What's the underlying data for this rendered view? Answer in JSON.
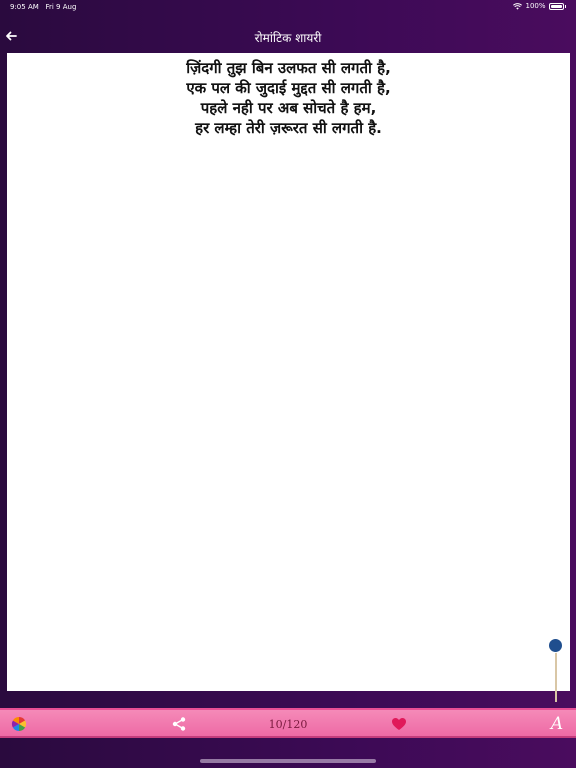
{
  "status": {
    "time": "9:05 AM",
    "date": "Fri 9 Aug",
    "battery": "100%"
  },
  "header": {
    "title": "रोमांटिक शायरी"
  },
  "poem": {
    "lines": [
      "ज़िंदगी तुझ बिन उलफत सी लगती है,",
      "एक पल की जुदाई मुद्दत सी लगती है,",
      "पहले नही पर अब सोचते है हम,",
      "हर लम्हा तेरी ज़रूरत सी लगती है."
    ]
  },
  "slider": {
    "value": 1.0
  },
  "bottom_bar": {
    "page_counter": "10/120",
    "font_label": "A"
  },
  "colors": {
    "background": "#3c0a55",
    "bottom_bar": "#ee6aa5",
    "heart": "#e0195a",
    "slider_knob": "#1f4e8e"
  },
  "icons": {
    "back": "arrow-left-icon",
    "color_wheel": "color-wheel-icon",
    "share": "share-icon",
    "heart": "heart-icon",
    "font": "font-icon"
  }
}
